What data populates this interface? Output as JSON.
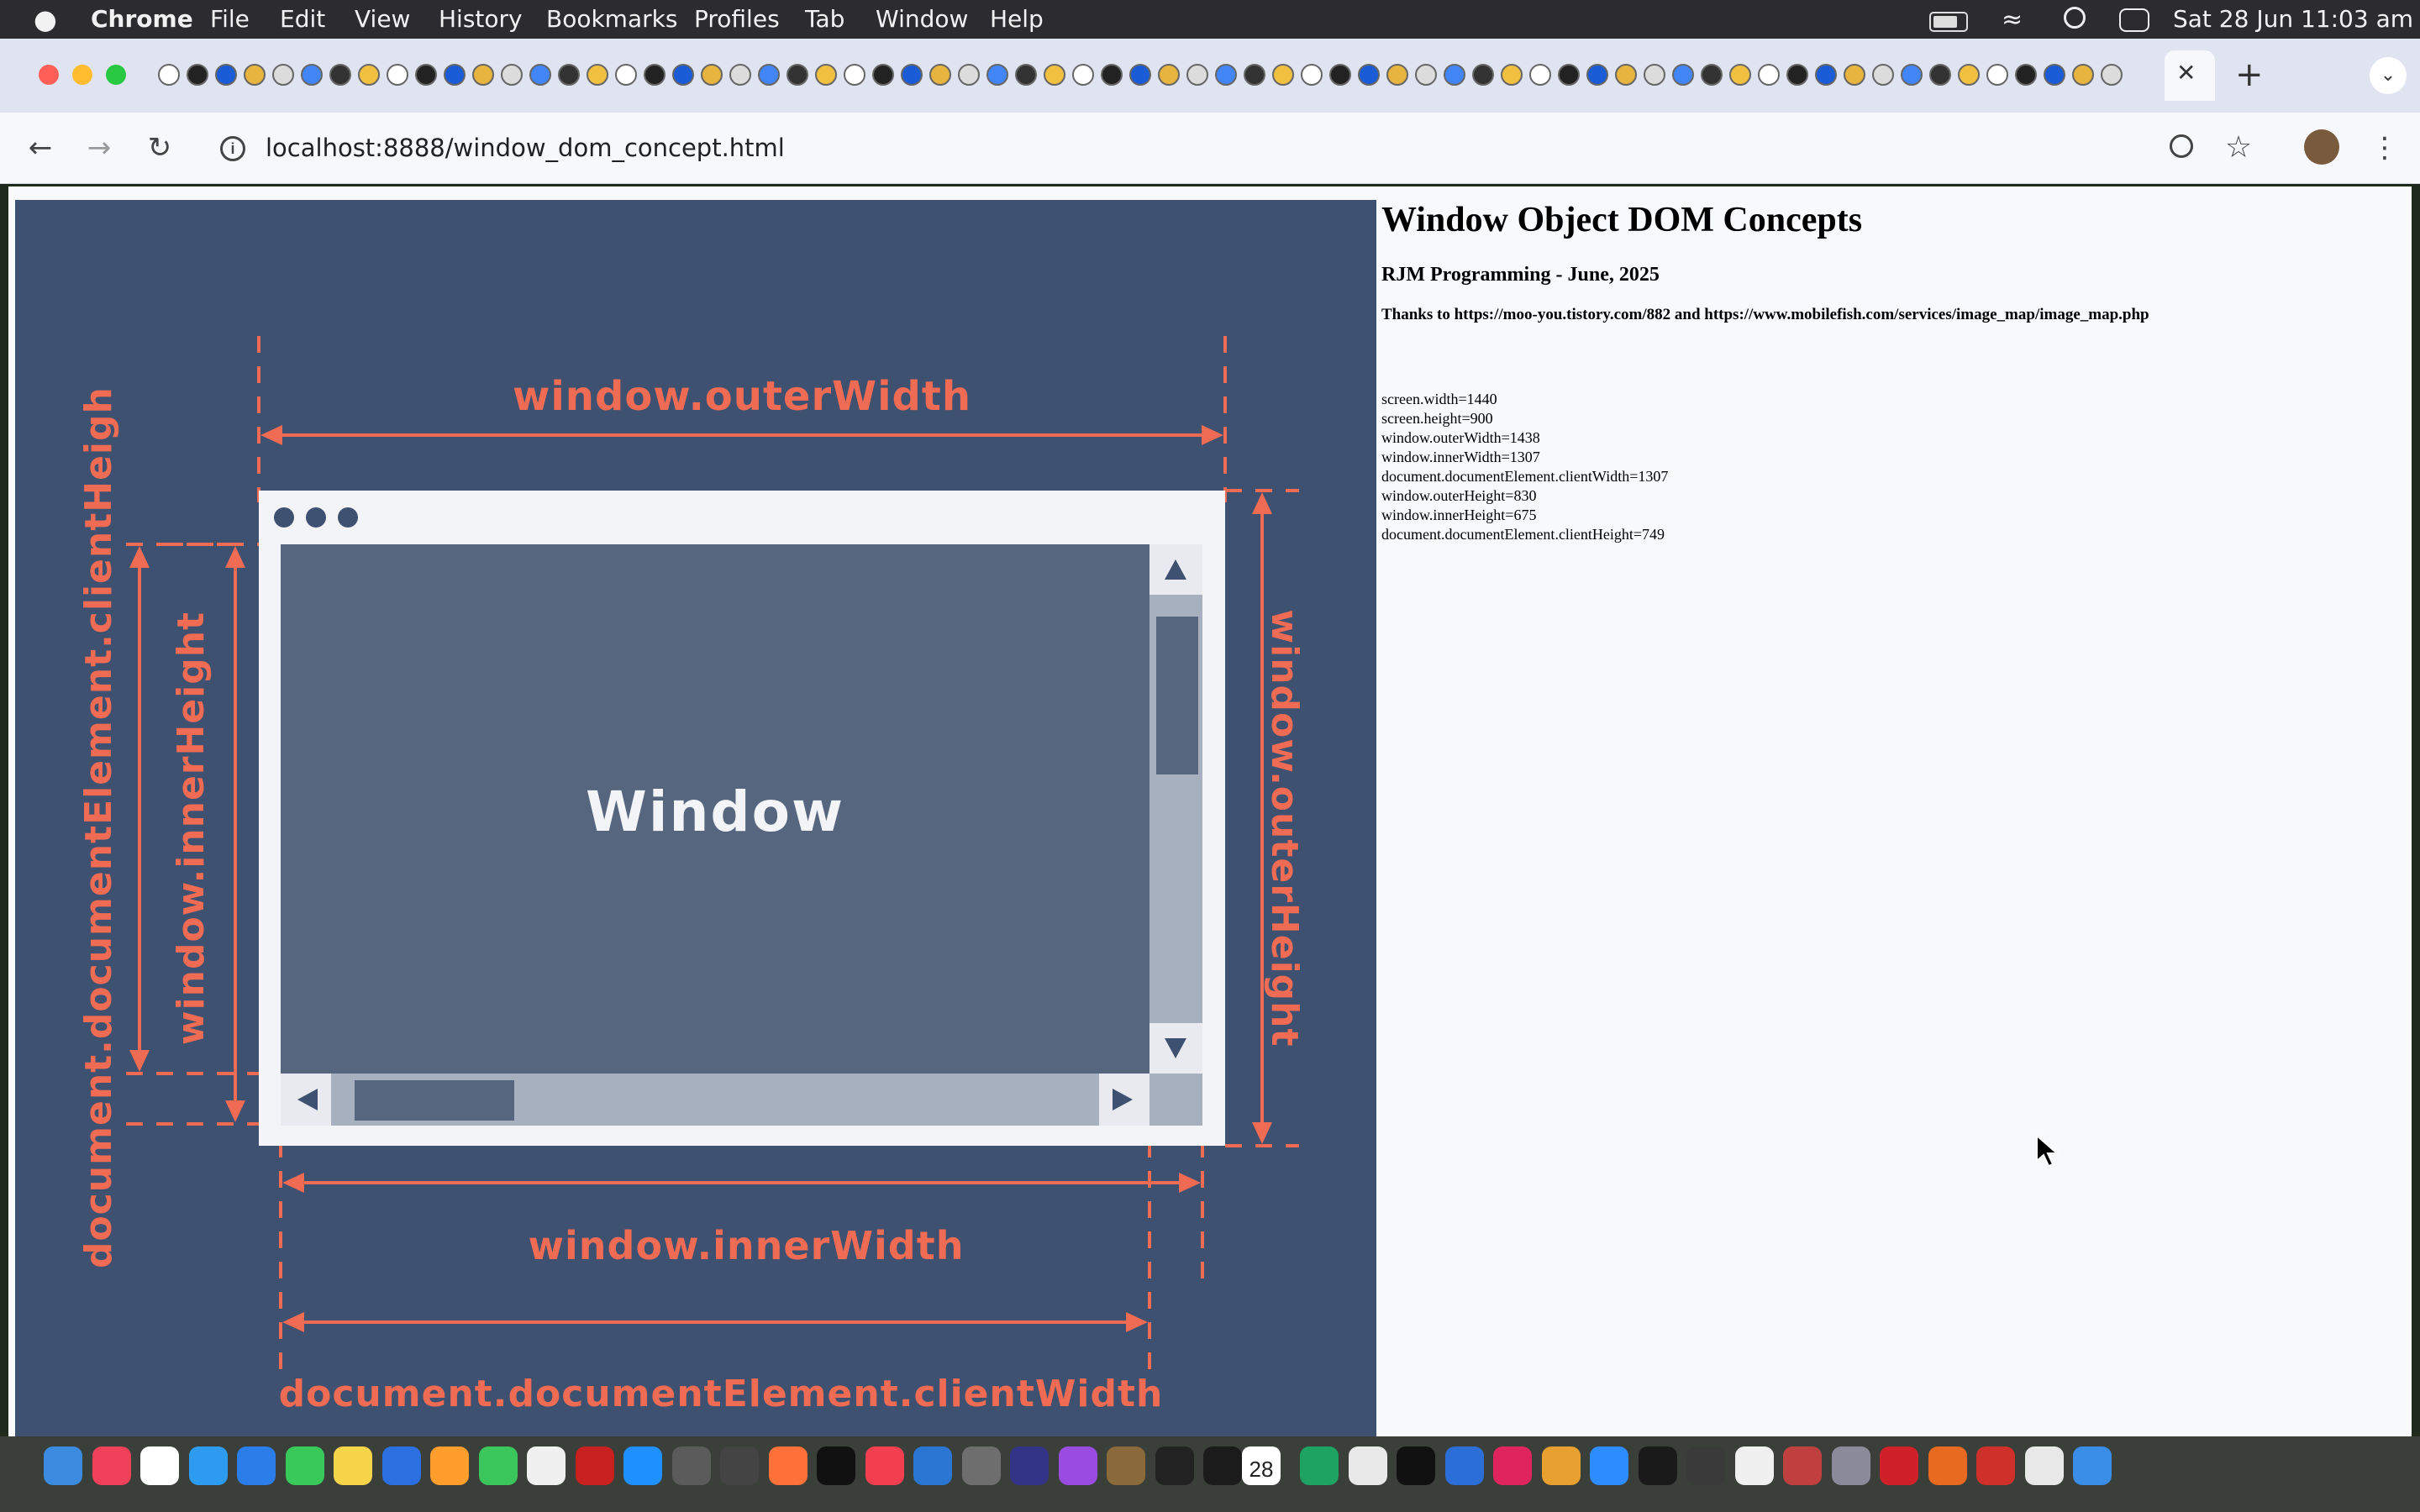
{
  "menubar": {
    "apple": "",
    "items": [
      "Chrome",
      "File",
      "Edit",
      "View",
      "History",
      "Bookmarks",
      "Profiles",
      "Tab",
      "Window",
      "Help"
    ],
    "clock": "Sat 28 Jun  11:03 am"
  },
  "browser": {
    "url": "localhost:8888/window_dom_concept.html",
    "new_tab": "+",
    "close_tab": "✕"
  },
  "diagram": {
    "window_label": "Window",
    "outer_width_label": "window.outerWidth",
    "inner_width_label": "window.innerWidth",
    "client_width_label": "document.documentElement.clientWidth",
    "outer_height_label": "window.outerHeight",
    "inner_height_label": "window.innerHeight",
    "client_height_label": "document.documentElement.clientHeigh"
  },
  "page": {
    "title": "Window Object DOM Concepts",
    "byline": "RJM Programming - June, 2025",
    "thanks": "Thanks to https://moo-you.tistory.com/882 and https://www.mobilefish.com/services/image_map/image_map.php",
    "metrics": [
      "screen.width=1440",
      "screen.height=900",
      "window.outerWidth=1438",
      "window.innerWidth=1307",
      "document.documentElement.clientWidth=1307",
      "window.outerHeight=830",
      "window.innerHeight=675",
      "document.documentElement.clientHeight=749"
    ]
  },
  "dock": {
    "calendar_day": "28"
  },
  "colors": {
    "diagram_bg": "#3f5170",
    "accent": "#ef6b53",
    "window_body": "#56667f"
  }
}
